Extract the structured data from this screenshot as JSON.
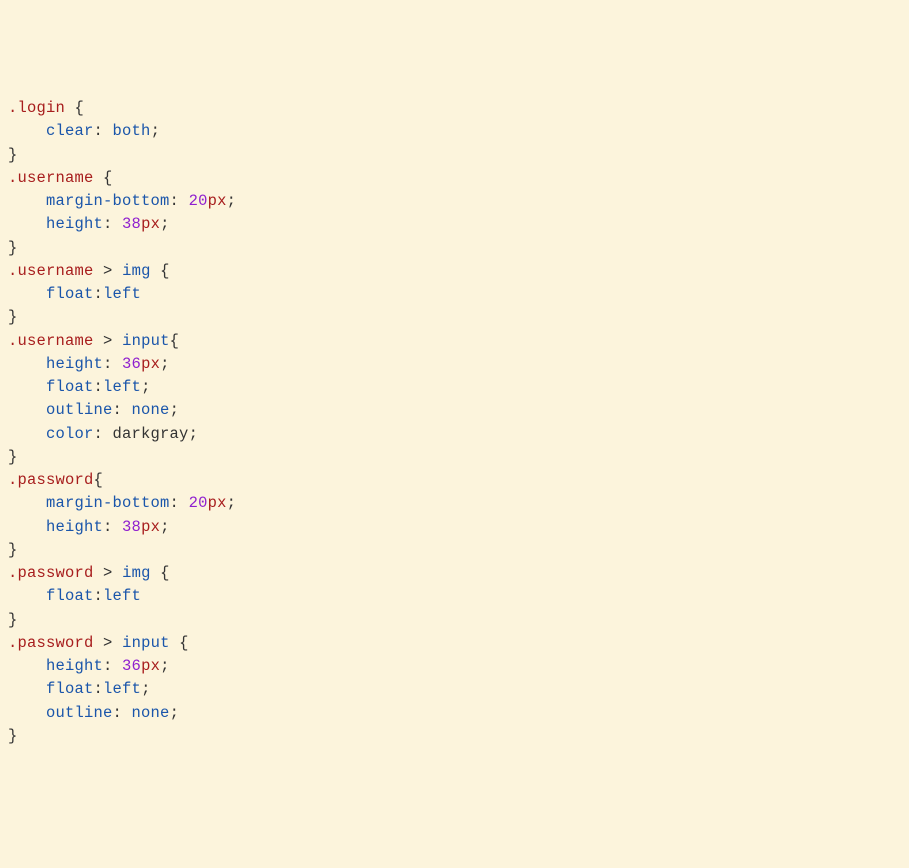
{
  "lines": [
    [
      [
        "sel",
        ".login"
      ],
      [
        "plain",
        " "
      ],
      [
        "brace",
        "{"
      ]
    ],
    [
      [
        "plain",
        "    "
      ],
      [
        "tag",
        "clear"
      ],
      [
        "plain",
        ": "
      ],
      [
        "kw",
        "both"
      ],
      [
        "plain",
        ";"
      ]
    ],
    [
      [
        "brace",
        "}"
      ]
    ],
    [
      [
        "sel",
        ".username"
      ],
      [
        "plain",
        " "
      ],
      [
        "brace",
        "{"
      ]
    ],
    [
      [
        "plain",
        "    "
      ],
      [
        "tag",
        "margin-bottom"
      ],
      [
        "plain",
        ": "
      ],
      [
        "num",
        "20"
      ],
      [
        "unit",
        "px"
      ],
      [
        "plain",
        ";"
      ]
    ],
    [
      [
        "plain",
        "    "
      ],
      [
        "tag",
        "height"
      ],
      [
        "plain",
        ": "
      ],
      [
        "num",
        "38"
      ],
      [
        "unit",
        "px"
      ],
      [
        "plain",
        ";"
      ]
    ],
    [
      [
        "brace",
        "}"
      ]
    ],
    [
      [
        "sel",
        ".username"
      ],
      [
        "plain",
        " "
      ],
      [
        "gt",
        ">"
      ],
      [
        "plain",
        " "
      ],
      [
        "tag",
        "img"
      ],
      [
        "plain",
        " "
      ],
      [
        "brace",
        "{"
      ]
    ],
    [
      [
        "plain",
        "    "
      ],
      [
        "tag",
        "float"
      ],
      [
        "plain",
        ":"
      ],
      [
        "kw",
        "left"
      ]
    ],
    [
      [
        "brace",
        "}"
      ]
    ],
    [
      [
        "sel",
        ".username"
      ],
      [
        "plain",
        " "
      ],
      [
        "gt",
        ">"
      ],
      [
        "plain",
        " "
      ],
      [
        "tag",
        "input"
      ],
      [
        "brace",
        "{"
      ]
    ],
    [
      [
        "plain",
        "    "
      ],
      [
        "tag",
        "height"
      ],
      [
        "plain",
        ": "
      ],
      [
        "num",
        "36"
      ],
      [
        "unit",
        "px"
      ],
      [
        "plain",
        ";"
      ]
    ],
    [
      [
        "plain",
        "    "
      ],
      [
        "tag",
        "float"
      ],
      [
        "plain",
        ":"
      ],
      [
        "kw",
        "left"
      ],
      [
        "plain",
        ";"
      ]
    ],
    [
      [
        "plain",
        "    "
      ],
      [
        "tag",
        "outline"
      ],
      [
        "plain",
        ": "
      ],
      [
        "kw",
        "none"
      ],
      [
        "plain",
        ";"
      ]
    ],
    [
      [
        "plain",
        "    "
      ],
      [
        "tag",
        "color"
      ],
      [
        "plain",
        ": "
      ],
      [
        "plain",
        "darkgray"
      ],
      [
        "plain",
        ";"
      ]
    ],
    [
      [
        "brace",
        "}"
      ]
    ],
    [
      [
        "sel",
        ".password"
      ],
      [
        "brace",
        "{"
      ]
    ],
    [
      [
        "plain",
        "    "
      ],
      [
        "tag",
        "margin-bottom"
      ],
      [
        "plain",
        ": "
      ],
      [
        "num",
        "20"
      ],
      [
        "unit",
        "px"
      ],
      [
        "plain",
        ";"
      ]
    ],
    [
      [
        "plain",
        "    "
      ],
      [
        "tag",
        "height"
      ],
      [
        "plain",
        ": "
      ],
      [
        "num",
        "38"
      ],
      [
        "unit",
        "px"
      ],
      [
        "plain",
        ";"
      ]
    ],
    [
      [
        "brace",
        "}"
      ]
    ],
    [
      [
        "sel",
        ".password"
      ],
      [
        "plain",
        " "
      ],
      [
        "gt",
        ">"
      ],
      [
        "plain",
        " "
      ],
      [
        "tag",
        "img"
      ],
      [
        "plain",
        " "
      ],
      [
        "brace",
        "{"
      ]
    ],
    [
      [
        "plain",
        "    "
      ],
      [
        "tag",
        "float"
      ],
      [
        "plain",
        ":"
      ],
      [
        "kw",
        "left"
      ]
    ],
    [
      [
        "brace",
        "}"
      ]
    ],
    [
      [
        "sel",
        ".password"
      ],
      [
        "plain",
        " "
      ],
      [
        "gt",
        ">"
      ],
      [
        "plain",
        " "
      ],
      [
        "tag",
        "input"
      ],
      [
        "plain",
        " "
      ],
      [
        "brace",
        "{"
      ]
    ],
    [
      [
        "plain",
        "    "
      ],
      [
        "tag",
        "height"
      ],
      [
        "plain",
        ": "
      ],
      [
        "num",
        "36"
      ],
      [
        "unit",
        "px"
      ],
      [
        "plain",
        ";"
      ]
    ],
    [
      [
        "plain",
        "    "
      ],
      [
        "tag",
        "float"
      ],
      [
        "plain",
        ":"
      ],
      [
        "kw",
        "left"
      ],
      [
        "plain",
        ";"
      ]
    ],
    [
      [
        "plain",
        "    "
      ],
      [
        "tag",
        "outline"
      ],
      [
        "plain",
        ": "
      ],
      [
        "kw",
        "none"
      ],
      [
        "plain",
        ";"
      ]
    ],
    [
      [
        "brace",
        "}"
      ]
    ]
  ]
}
